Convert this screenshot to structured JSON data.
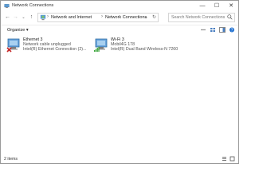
{
  "window": {
    "title": "Network Connections",
    "title_icon": "network-connections-icon",
    "minimize": "—",
    "maximize": "☐",
    "close": "✕"
  },
  "nav": {
    "back": "←",
    "forward": "→",
    "recent": "⌄",
    "up": "↑",
    "breadcrumb": [
      "Network and Internet",
      "Network Connections"
    ],
    "separator": "›",
    "dropdown": "⌄",
    "refresh": "↻",
    "search_placeholder": "Search Network Connections"
  },
  "commandbar": {
    "organize_label": "Organize ▾",
    "icons": [
      "more-options-icon",
      "change-view-icon",
      "preview-pane-icon",
      "help-icon"
    ]
  },
  "connections": [
    {
      "name": "Ethernet 3",
      "status": "Network cable unplugged",
      "device": "Intel(R) Ethernet Connection (2)...",
      "icon": "ethernet-adapter-icon",
      "status_color": "#c62828"
    },
    {
      "name": "Wi-Fi 3",
      "status": "Mobil4G 178",
      "device": "Intel(R) Dual Band Wireless-N 7260",
      "icon": "wifi-adapter-icon",
      "status_color": "#3aa53a"
    }
  ],
  "statusbar": {
    "count": "2 items"
  },
  "colors": {
    "accent": "#0078d7",
    "folder": "#e8b84a"
  }
}
